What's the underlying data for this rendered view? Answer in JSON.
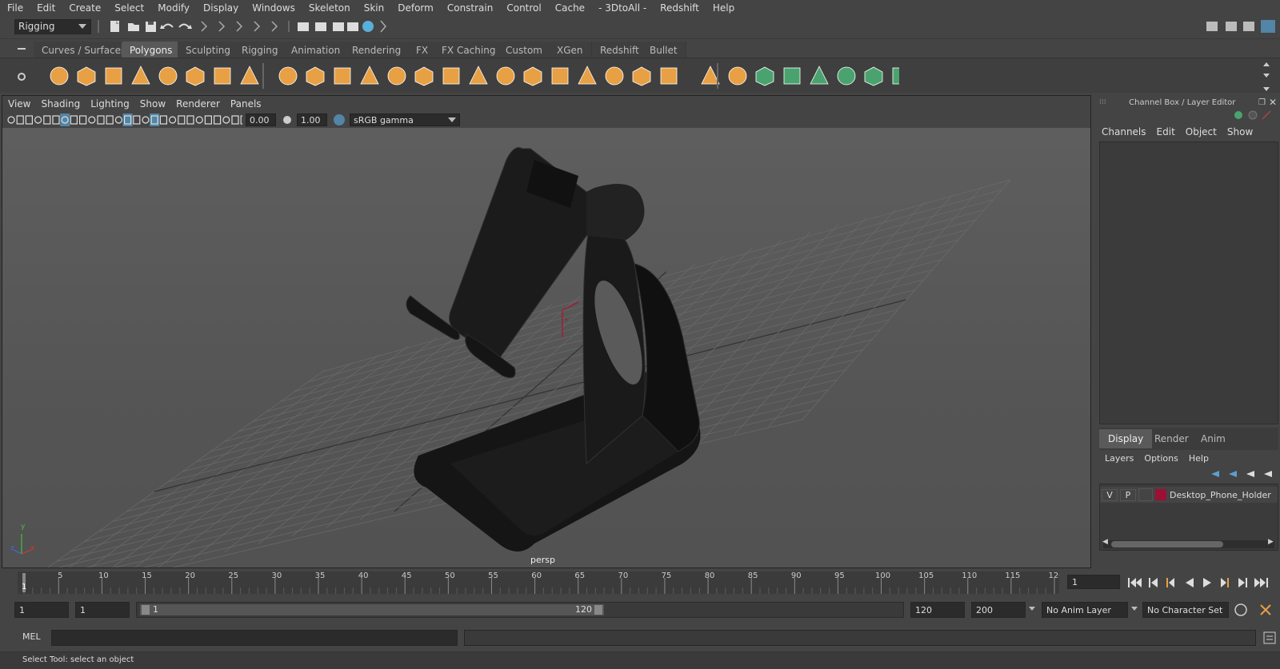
{
  "menubar": [
    "File",
    "Edit",
    "Create",
    "Select",
    "Modify",
    "Display",
    "Windows",
    "Skeleton",
    "Skin",
    "Deform",
    "Constrain",
    "Control",
    "Cache",
    "- 3DtoAll -",
    "Redshift",
    "Help"
  ],
  "status": {
    "mode": "Rigging"
  },
  "shelf_tabs": [
    "Curves / Surfaces",
    "Polygons",
    "Sculpting",
    "Rigging",
    "Animation",
    "Rendering",
    "FX",
    "FX Caching",
    "Custom",
    "XGen",
    "Redshift",
    "Bullet"
  ],
  "shelf_active": "Polygons",
  "viewport": {
    "menu": [
      "View",
      "Shading",
      "Lighting",
      "Show",
      "Renderer",
      "Panels"
    ],
    "exposure": "0.00",
    "gamma": "1.00",
    "color_space": "sRGB gamma",
    "camera": "persp",
    "axis": {
      "y": "y",
      "x": "x",
      "z": "z"
    }
  },
  "channel_box": {
    "title": "Channel Box / Layer Editor",
    "menu": [
      "Channels",
      "Edit",
      "Object",
      "Show"
    ],
    "tabs": [
      "Display",
      "Render",
      "Anim"
    ],
    "active_tab": "Display",
    "layer_menu": [
      "Layers",
      "Options",
      "Help"
    ],
    "layer": {
      "v": "V",
      "p": "P",
      "name": "Desktop_Phone_Holder",
      "color": "#9b1033"
    }
  },
  "timeline": {
    "ticks": [
      "5",
      "10",
      "15",
      "20",
      "25",
      "30",
      "35",
      "40",
      "45",
      "50",
      "55",
      "60",
      "65",
      "70",
      "75",
      "80",
      "85",
      "90",
      "95",
      "100",
      "105",
      "110",
      "115",
      "120"
    ],
    "current_frame_marker": "1",
    "current_frame": "1"
  },
  "range": {
    "start": "1",
    "playback_start": "1",
    "slider_start": "1",
    "slider_end": "120",
    "playback_end": "120",
    "end": "200",
    "anim_layer": "No Anim Layer",
    "character_set": "No Character Set"
  },
  "cmdline": {
    "label": "MEL"
  },
  "helpline": {
    "text": "Select Tool: select an object"
  },
  "colors": {
    "accent": "#5285a6",
    "icon_orange": "#e8a045",
    "icon_green": "#4aa36f",
    "layer_red": "#9b1033"
  }
}
